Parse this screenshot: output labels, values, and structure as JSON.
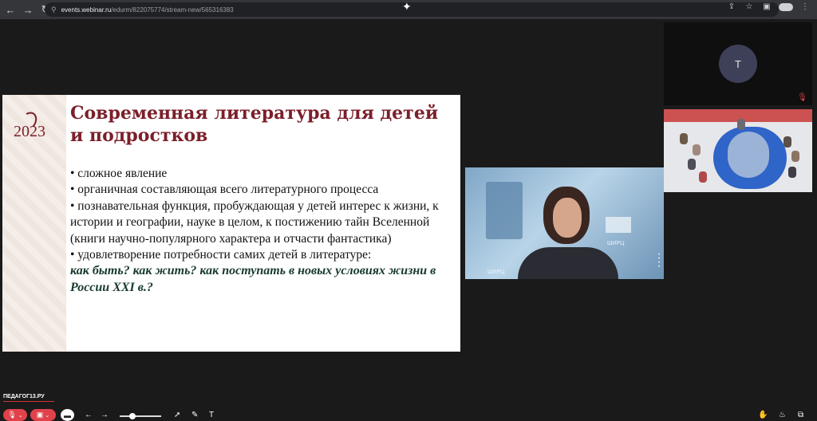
{
  "browser": {
    "url_host": "events.webinar.ru",
    "url_path": "/edurm/822075774/stream-new/565316383",
    "back_icon": "arrow-left-icon",
    "forward_icon": "arrow-right-icon",
    "reload_icon": "reload-icon"
  },
  "slide": {
    "title": "Современная литература для детей и подростков",
    "logo_year": "2023",
    "bullets": [
      "• сложное явление",
      "• органичная составляющая всего литературного процесса",
      "• познавательная функция, пробуждающая у детей интерес к жизни, к истории и географии, науке в целом, к постижению тайн Вселенной (книги научно-популярного характера и отчасти фантастика)",
      "• удовлетворение потребности самих детей в литературе:"
    ],
    "emphasis": "как быть? как жить? как поступать в новых условиях жизни в России XXI в.?"
  },
  "speaker": {
    "label_left": "ШИРЦ",
    "label_right": "ШИРЦ"
  },
  "participant": {
    "initial": "Т"
  },
  "brand": {
    "text": "ПЕДАГОГ13.РУ"
  },
  "colors": {
    "slide_title": "#7b1f2a",
    "emphasis": "#173a2c",
    "mic_red": "#e0424b"
  }
}
